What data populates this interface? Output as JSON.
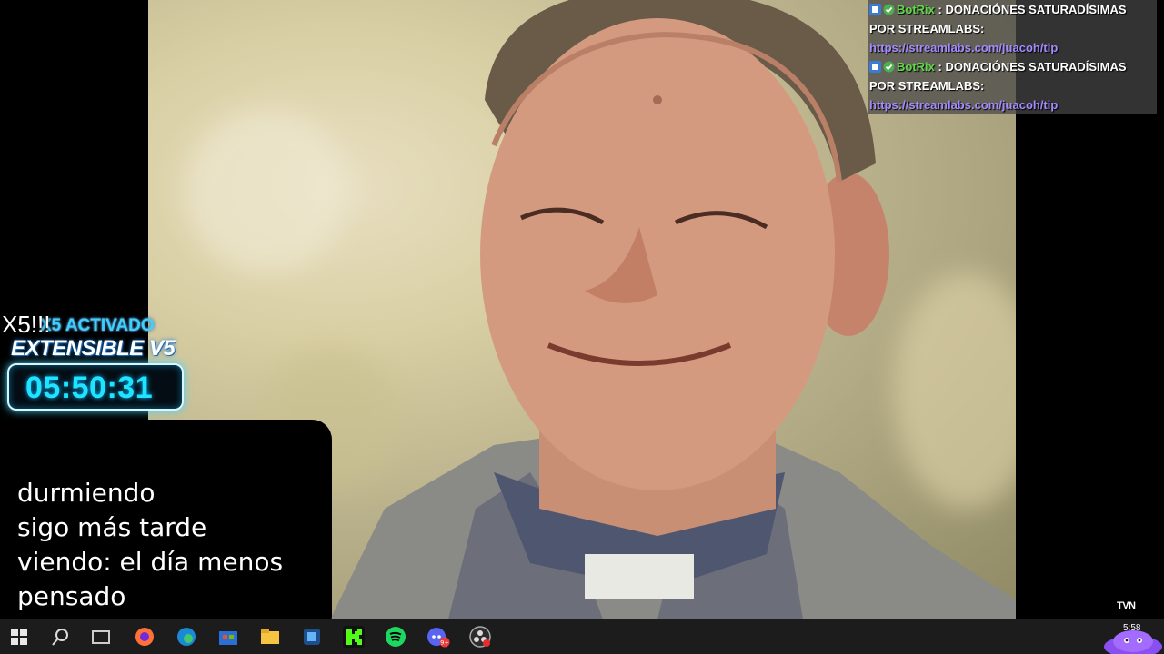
{
  "chat": {
    "messages": [
      {
        "user": "BotRix",
        "separator": " : ",
        "text": "DONACIÓNES SATURADÍSIMAS POR STREAMLABS: ",
        "link": "https://streamlabs.com/juacoh/tip"
      },
      {
        "user": "BotRix",
        "separator": " : ",
        "text": "DONACIÓNES SATURADÍSIMAS POR STREAMLABS: ",
        "link": "https://streamlabs.com/juacoh/tip"
      }
    ],
    "colors": {
      "user": "#5fd94a",
      "link": "#a48bff"
    }
  },
  "timer": {
    "multiplier": "X5!!!",
    "status": "X5 ACTIVADO",
    "title": "EXTENSIBLE V5",
    "value": "05:50:31"
  },
  "note": {
    "lines": [
      "durmiendo",
      "sigo más tarde",
      "viendo: el día menos",
      "pensado"
    ]
  },
  "video": {
    "channel_logo": "TVN"
  },
  "taskbar": {
    "clock": "5:58",
    "icons": [
      "windows-start-icon",
      "search-icon",
      "task-view-icon",
      "firefox-icon",
      "edge-icon",
      "store-icon",
      "file-explorer-icon",
      "app-icon",
      "kick-icon",
      "spotify-icon",
      "discord-icon",
      "obs-icon"
    ],
    "discord_badge": "9+"
  }
}
